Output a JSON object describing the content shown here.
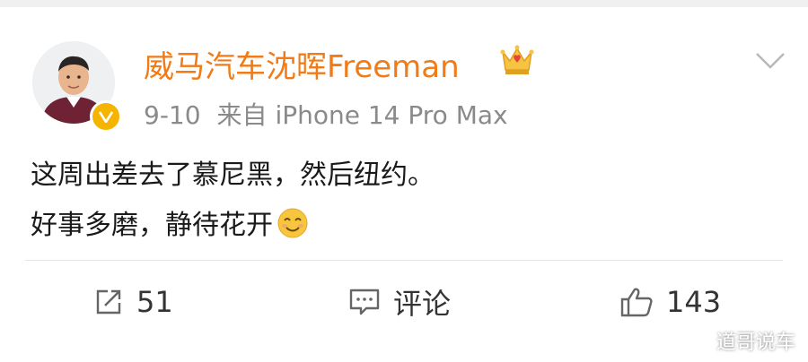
{
  "post": {
    "username": "威马汽车沈晖Freeman",
    "date": "9-10",
    "source": "来自 iPhone 14 Pro Max",
    "content_line1": "这周出差去了慕尼黑，然后纽约。",
    "content_line2": "好事多磨，静待花开",
    "emoji": "smiling-face-emoji",
    "avatar": "avatar-photo",
    "verified_badge": "verified-v-badge",
    "member_badge": "crown-icon"
  },
  "actions": {
    "share_count": "51",
    "comment_label": "评论",
    "like_count": "143"
  },
  "watermark": {
    "text": "道哥说车"
  },
  "colors": {
    "username": "#f07b17",
    "meta": "#8a8a8a",
    "badge": "#f5b400"
  }
}
